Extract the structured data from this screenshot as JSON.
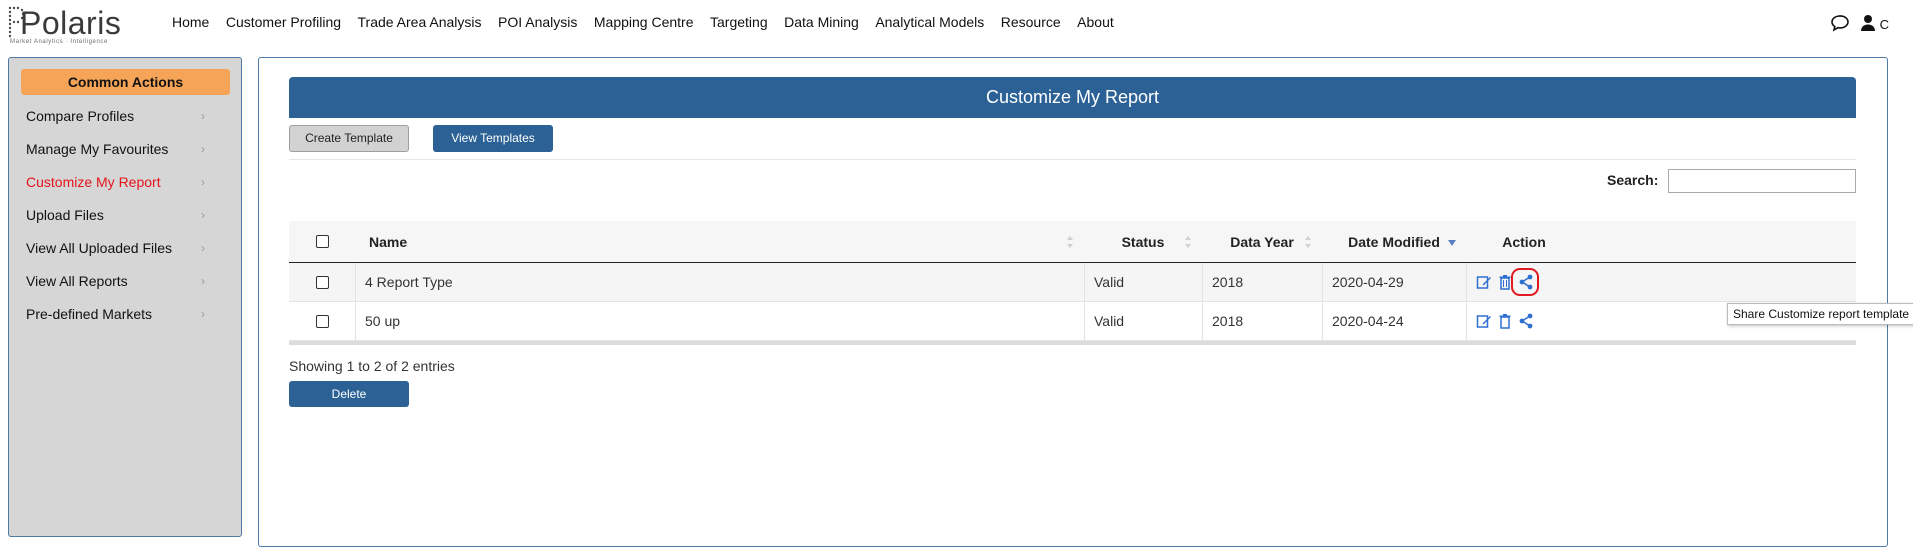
{
  "brand": {
    "name": "Polaris",
    "tagline": "Market Analytics · Intelligence"
  },
  "nav": {
    "items": [
      "Home",
      "Customer Profiling",
      "Trade Area Analysis",
      "POI Analysis",
      "Mapping Centre",
      "Targeting",
      "Data Mining",
      "Analytical Models",
      "Resource",
      "About"
    ]
  },
  "topright": {
    "chat_icon": "chat-icon",
    "user_icon": "user-icon",
    "user_initial": "C"
  },
  "sidebar": {
    "header": "Common Actions",
    "items": [
      {
        "label": "Compare Profiles",
        "active": false
      },
      {
        "label": "Manage My Favourites",
        "active": false
      },
      {
        "label": "Customize My Report",
        "active": true
      },
      {
        "label": "Upload Files",
        "active": false
      },
      {
        "label": "View All Uploaded Files",
        "active": false
      },
      {
        "label": "View All Reports",
        "active": false
      },
      {
        "label": "Pre-defined Markets",
        "active": false
      }
    ]
  },
  "main": {
    "title": "Customize My Report",
    "create_template_label": "Create Template",
    "view_templates_label": "View Templates",
    "search_label": "Search:",
    "search_value": "",
    "columns": [
      "Name",
      "Status",
      "Data Year",
      "Date Modified",
      "Action"
    ],
    "rows": [
      {
        "name": "4 Report Type",
        "status": "Valid",
        "year": "2018",
        "modified": "2020-04-29"
      },
      {
        "name": "50 up",
        "status": "Valid",
        "year": "2018",
        "modified": "2020-04-24"
      }
    ],
    "showing": "Showing 1 to 2 of 2 entries",
    "delete_label": "Delete",
    "tooltip": "Share Customize report template"
  },
  "colors": {
    "primary": "#2b6194",
    "accent": "#f6a457",
    "active_link": "#e4141c",
    "highlight": "#e01a20"
  }
}
